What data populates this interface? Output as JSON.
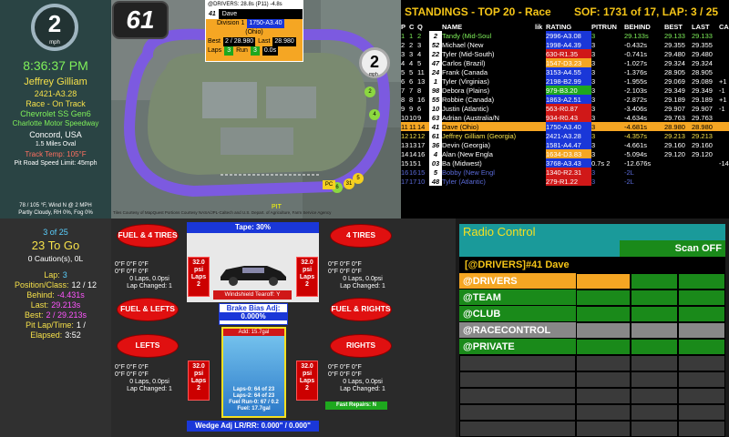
{
  "left": {
    "position": "2",
    "pos_unit": "mph",
    "clock": "8:36:37 PM",
    "driver_name": "Jeffrey Gilliam",
    "license": "2421-A3.28",
    "session": "Race - On Track",
    "car": "Chevrolet SS Gen6",
    "track": "Charlotte Motor Speedway",
    "location": "Concord, USA",
    "track_length": "1.5 Miles Oval",
    "track_temp": "Track Temp: 105°F",
    "pit_speed": "Pit Road Speed Limit: 45mph",
    "weather1": "78 / 105 °F, Wind N @ 2 MPH",
    "weather2": "Partly Cloudy, RH 0%, Fog 0%",
    "laps_of": "3 of 25",
    "to_go": "23 To Go",
    "cautions": "0 Caution(s), 0L",
    "stats": [
      {
        "label": "Lap:",
        "value": "3",
        "color": "#5ad0ff"
      },
      {
        "label": "Position/Class:",
        "value": "12 / 12",
        "color": "#ffffff"
      },
      {
        "label": "Behind:",
        "value": "-4.431s",
        "color": "#ff55ff"
      },
      {
        "label": "Last:",
        "value": "29.213s",
        "color": "#ff55ff"
      },
      {
        "label": "Best:",
        "value": "2 / 29.213s",
        "color": "#ff55ff"
      },
      {
        "label": "Pit Lap/Time:",
        "value": "1 /",
        "color": "#ffffff"
      },
      {
        "label": "Elapsed:",
        "value": "3:52",
        "color": "#ffffff"
      }
    ]
  },
  "car_number": "61",
  "driver_card": {
    "header": "@DRIVERS: 28.8s (P11) -4.8s",
    "car": "41",
    "name": "Dave",
    "division_label": "Division 1",
    "division_value": "1750-A3.40",
    "region": "(Ohio)",
    "best_label": "Best",
    "best_value": "2 / 28.980",
    "last_label": "Last",
    "last_value": "28.980",
    "laps_label": "Laps",
    "laps_value": "3",
    "run_label": "Run",
    "run_value": "3",
    "time_value": "0.0s"
  },
  "map": {
    "attribution": "Tiles Courtesy of MapQuest Portions Courtesy NASA/JPL-Caltech and U.S. Depart. of Agriculture, Farm Service Agency",
    "pos_marker": "2",
    "pos_unit": "mph",
    "markers": [
      "61",
      "2",
      "4",
      "6",
      "31",
      "5",
      "12",
      "PIT"
    ],
    "tags": [
      "PC",
      "56"
    ]
  },
  "standings": {
    "title": "STANDINGS - TOP 20 - Race",
    "sof": "SOF: 1731 of 17, LAP: 3 / 25",
    "columns": [
      "P",
      "C",
      "Q",
      "",
      "NAME",
      "lik",
      "RATING",
      "PITRUN",
      "BEHIND",
      "BEST",
      "LAST",
      "CA"
    ],
    "rows": [
      {
        "p": "1",
        "c": "1",
        "q": "2",
        "car": "2",
        "name": "Tandy (Mid-Soul",
        "rating": "2996-A3.08",
        "rc": "#1a37d8",
        "pit": "3",
        "behind": "29.133s",
        "best": "29.133",
        "last": "29.133",
        "ca": "",
        "style": "green"
      },
      {
        "p": "2",
        "c": "2",
        "q": "3",
        "car": "52",
        "name": "Michael (New",
        "rating": "1998-A4.39",
        "rc": "#1a37d8",
        "pit": "3",
        "behind": "-0.432s",
        "best": "29.355",
        "last": "29.355",
        "ca": "",
        "style": ""
      },
      {
        "p": "3",
        "c": "3",
        "q": "4",
        "car": "22",
        "name": "Tyler (Mid-South)",
        "rating": "630-R1.35",
        "rc": "#d01818",
        "pit": "3",
        "behind": "-0.741s",
        "best": "29.480",
        "last": "29.480",
        "ca": "",
        "style": ""
      },
      {
        "p": "4",
        "c": "4",
        "q": "5",
        "car": "47",
        "name": "Carlos (Brazil)",
        "rating": "1547-D3.23",
        "rc": "#f5a623",
        "pit": "3",
        "behind": "-1.027s",
        "best": "29.324",
        "last": "29.324",
        "ca": "",
        "style": ""
      },
      {
        "p": "5",
        "c": "5",
        "q": "11",
        "car": "24",
        "name": "Frank (Canada",
        "rating": "3153-A4.55",
        "rc": "#1a37d8",
        "pit": "3",
        "behind": "-1.376s",
        "best": "28.905",
        "last": "28.905",
        "ca": "",
        "style": ""
      },
      {
        "p": "6",
        "c": "6",
        "q": "13",
        "car": "1",
        "name": "Tyler (Virginias)",
        "rating": "2198-B2.99",
        "rc": "#1a37d8",
        "pit": "3",
        "behind": "-1.955s",
        "best": "29.069",
        "last": "29.089",
        "ca": "+1",
        "style": ""
      },
      {
        "p": "7",
        "c": "7",
        "q": "8",
        "car": "98",
        "name": "Debora (Plains)",
        "rating": "979-B3.20",
        "rc": "#1ea81e",
        "pit": "3",
        "behind": "-2.103s",
        "best": "29.349",
        "last": "29.349",
        "ca": "-1",
        "style": ""
      },
      {
        "p": "8",
        "c": "8",
        "q": "16",
        "car": "55",
        "name": "Robbie (Canada)",
        "rating": "1863-A2.51",
        "rc": "#1a37d8",
        "pit": "3",
        "behind": "-2.872s",
        "best": "29.189",
        "last": "29.189",
        "ca": "+1",
        "style": ""
      },
      {
        "p": "9",
        "c": "9",
        "q": "6",
        "car": "10",
        "name": "Justin (Atlantic)",
        "rating": "563-R0.87",
        "rc": "#d01818",
        "pit": "3",
        "behind": "-3.406s",
        "best": "29.907",
        "last": "29.907",
        "ca": "-1",
        "style": ""
      },
      {
        "p": "10",
        "c": "10",
        "q": "9",
        "car": "63",
        "name": "Adrian (Australia/N",
        "rating": "934-R0.43",
        "rc": "#d01818",
        "pit": "3",
        "behind": "-4.634s",
        "best": "29.763",
        "last": "29.763",
        "ca": "",
        "style": ""
      },
      {
        "p": "11",
        "c": "11",
        "q": "14",
        "car": "41",
        "name": "Dave (Ohio)",
        "rating": "1750-A3.40",
        "rc": "#1a37d8",
        "pit": "3",
        "behind": "-4.681s",
        "best": "28.980",
        "last": "28.980",
        "ca": "",
        "style": "orange"
      },
      {
        "p": "12",
        "c": "12",
        "q": "12",
        "car": "61",
        "name": "Jeffrey Gilliam (Georgia)",
        "rating": "2421-A3.28",
        "rc": "#1a37d8",
        "pit": "3",
        "behind": "-4.357s",
        "best": "29.213",
        "last": "29.213",
        "ca": "",
        "style": "self"
      },
      {
        "p": "13",
        "c": "13",
        "q": "17",
        "car": "36",
        "name": "Devin (Georgia)",
        "rating": "1581-A4.47",
        "rc": "#1a37d8",
        "pit": "3",
        "behind": "-4.661s",
        "best": "29.160",
        "last": "29.160",
        "ca": "",
        "style": ""
      },
      {
        "p": "14",
        "c": "14",
        "q": "16",
        "car": "4",
        "name": "Alan (New Engla",
        "rating": "1634-D3.83",
        "rc": "#f5a623",
        "pit": "3",
        "behind": "-5.094s",
        "best": "29.120",
        "last": "29.120",
        "ca": "",
        "style": ""
      },
      {
        "p": "15",
        "c": "15",
        "q": "1",
        "car": "03",
        "name": "Ba (Midwest)",
        "rating": "3768-A3.43",
        "rc": "#1a37d8",
        "pit": "0.7s 2",
        "behind": "-12.676s",
        "best": "",
        "last": "",
        "ca": "-14",
        "style": ""
      },
      {
        "p": "16",
        "c": "16",
        "q": "15",
        "car": "5",
        "name": "Bobby (New Engl",
        "rating": "1340-R2.31",
        "rc": "#d01818",
        "pit": "3",
        "behind": "-2L",
        "best": "",
        "last": "",
        "ca": "",
        "style": "dim"
      },
      {
        "p": "17",
        "c": "17",
        "q": "10",
        "car": "48",
        "name": "Tyler (Atlantic)",
        "rating": "279-R1.22",
        "rc": "#d01818",
        "pit": "3",
        "behind": "-2L",
        "best": "",
        "last": "",
        "ca": "",
        "style": "dim"
      }
    ]
  },
  "tires": {
    "btn_fuel_4": "FUEL & 4 TIRES",
    "btn_4": "4 TIRES",
    "btn_fuel_lefts": "FUEL & LEFTS",
    "btn_fuel_rights": "FUEL & RIGHTS",
    "btn_lefts": "LEFTS",
    "btn_rights": "RIGHTS",
    "tape": "Tape: 30%",
    "windshield": "Windshield Tearoff: Y",
    "brake_label": "Brake Bias Adj:",
    "brake_value": "0.000%",
    "fuel_header": "Add: 15.7gal",
    "laps_0": "Laps-0: 64 of 23",
    "laps_2": "Laps-2: 64 of 23",
    "fuel_run": "Fuel Run-0: 67 / 0.2",
    "fuel": "Fuel: 17.7gal",
    "fast_repairs": "Fast Repairs: N",
    "wedge": "Wedge Adj LR/RR: 0.000\" / 0.000\"",
    "psi": "32.0 psi",
    "laps_word": "Laps",
    "laps_n": "2",
    "temp_row": "0°F 0°F 0°F",
    "zero_laps": "0 Laps, 0.0psi",
    "lap_changed": "Lap Changed: 1"
  },
  "radio": {
    "title": "Radio Control",
    "scan": "Scan OFF",
    "active": "[@DRIVERS]#41 Dave",
    "channels": [
      {
        "label": "@DRIVERS",
        "color": "#f5a623"
      },
      {
        "label": "@TEAM",
        "color": "#1a8a1a"
      },
      {
        "label": "@CLUB",
        "color": "#1a8a1a"
      },
      {
        "label": "@RACECONTROL",
        "color": "#888888"
      },
      {
        "label": "@PRIVATE",
        "color": "#1a8a1a"
      }
    ]
  }
}
